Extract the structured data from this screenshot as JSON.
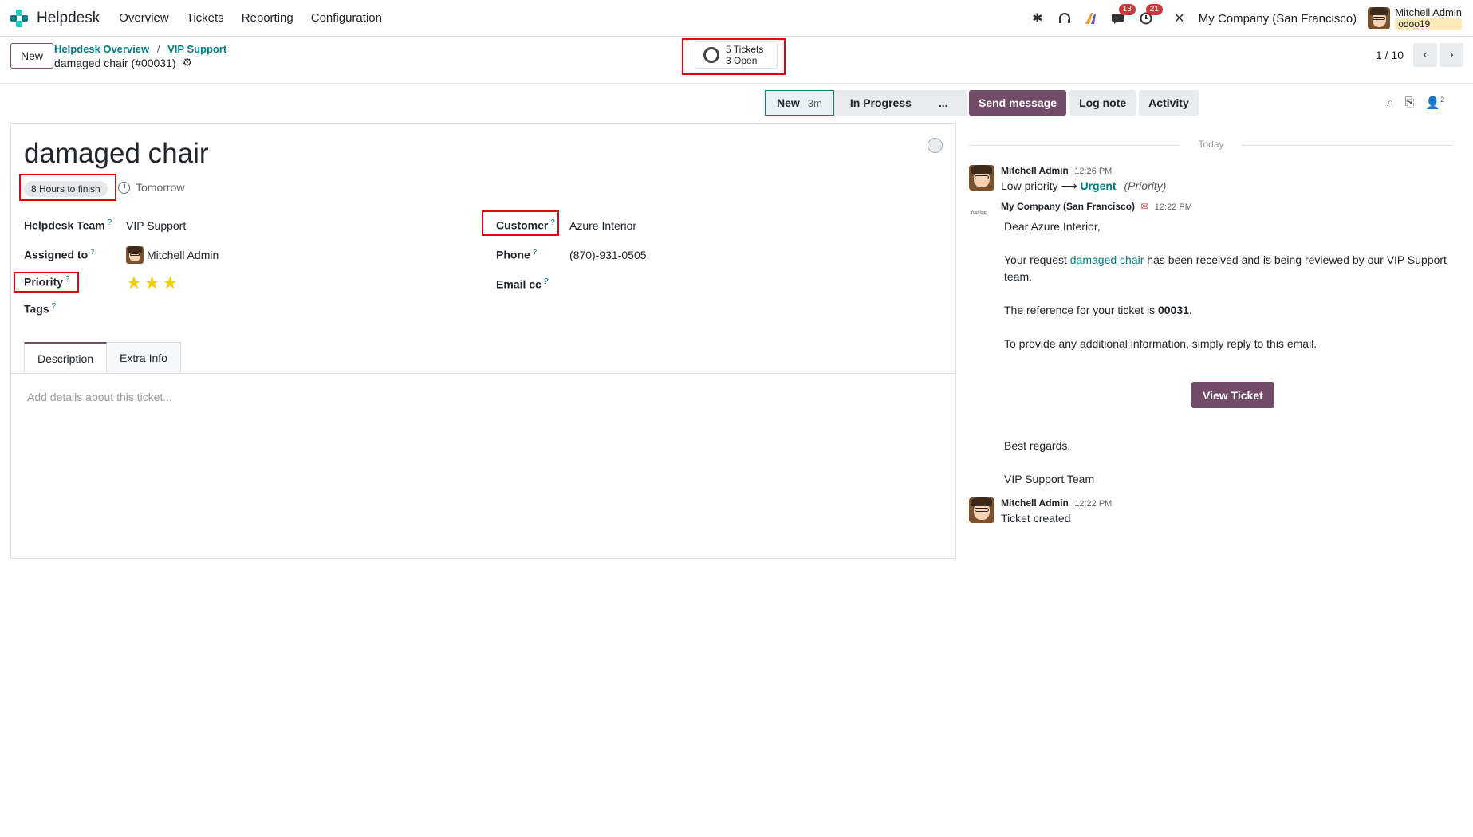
{
  "navbar": {
    "app_name": "Helpdesk",
    "menu": [
      "Overview",
      "Tickets",
      "Reporting",
      "Configuration"
    ],
    "messages_badge": "13",
    "activities_badge": "21",
    "company": "My Company (San Francisco)",
    "user_name": "Mitchell Admin",
    "database": "odoo19"
  },
  "control": {
    "new_label": "New",
    "breadcrumb": [
      "Helpdesk Overview",
      "VIP Support"
    ],
    "record_title": "damaged chair (#00031)",
    "smart_button": {
      "line1": "5 Tickets",
      "line2": "3 Open"
    },
    "pager": "1 / 10"
  },
  "statusbar": {
    "stages": [
      {
        "label": "New",
        "time": "3m",
        "active": true
      },
      {
        "label": "In Progress",
        "time": "",
        "active": false
      },
      {
        "label": "...",
        "time": "",
        "active": false
      }
    ]
  },
  "form": {
    "title": "damaged chair",
    "sla_tag": "8 Hours to finish",
    "deadline": "Tomorrow",
    "fields": {
      "team_label": "Helpdesk Team",
      "team_value": "VIP Support",
      "assigned_label": "Assigned to",
      "assigned_value": "Mitchell Admin",
      "priority_label": "Priority",
      "priority_stars": 3,
      "tags_label": "Tags",
      "customer_label": "Customer",
      "customer_value": "Azure Interior",
      "phone_label": "Phone",
      "phone_value": "(870)-931-0505",
      "emailcc_label": "Email cc"
    },
    "tabs": [
      "Description",
      "Extra Info"
    ],
    "description_placeholder": "Add details about this ticket..."
  },
  "chatter": {
    "buttons": [
      "Send message",
      "Log note",
      "Activity"
    ],
    "followers_count": "2",
    "date_separator": "Today",
    "messages": [
      {
        "author": "Mitchell Admin",
        "time": "12:26 PM",
        "old": "Low priority",
        "new": "Urgent",
        "field": "(Priority)"
      },
      {
        "author": "My Company (San Francisco)",
        "time": "12:22 PM"
      },
      {
        "author": "Mitchell Admin",
        "time": "12:22 PM",
        "body": "Ticket created"
      }
    ],
    "email": {
      "greeting": "Dear Azure Interior,",
      "line1_pre": "Your request ",
      "line1_link": "damaged chair",
      "line1_post": " has been received and is being reviewed by our VIP Support",
      "line1_cont": "team.",
      "line2_pre": "The reference for your ticket is ",
      "line2_ref": "00031",
      "line2_post": ".",
      "line3": "To provide any additional information, simply reply to this email.",
      "button": "View Ticket",
      "regards": "Best regards,",
      "signature": "VIP Support Team",
      "logo_text": "Your logo"
    }
  },
  "colors": {
    "primary": "#714b67",
    "link": "#017e84",
    "badge": "#d9343b",
    "star": "#f3cc00",
    "annotation": "#e60012"
  }
}
